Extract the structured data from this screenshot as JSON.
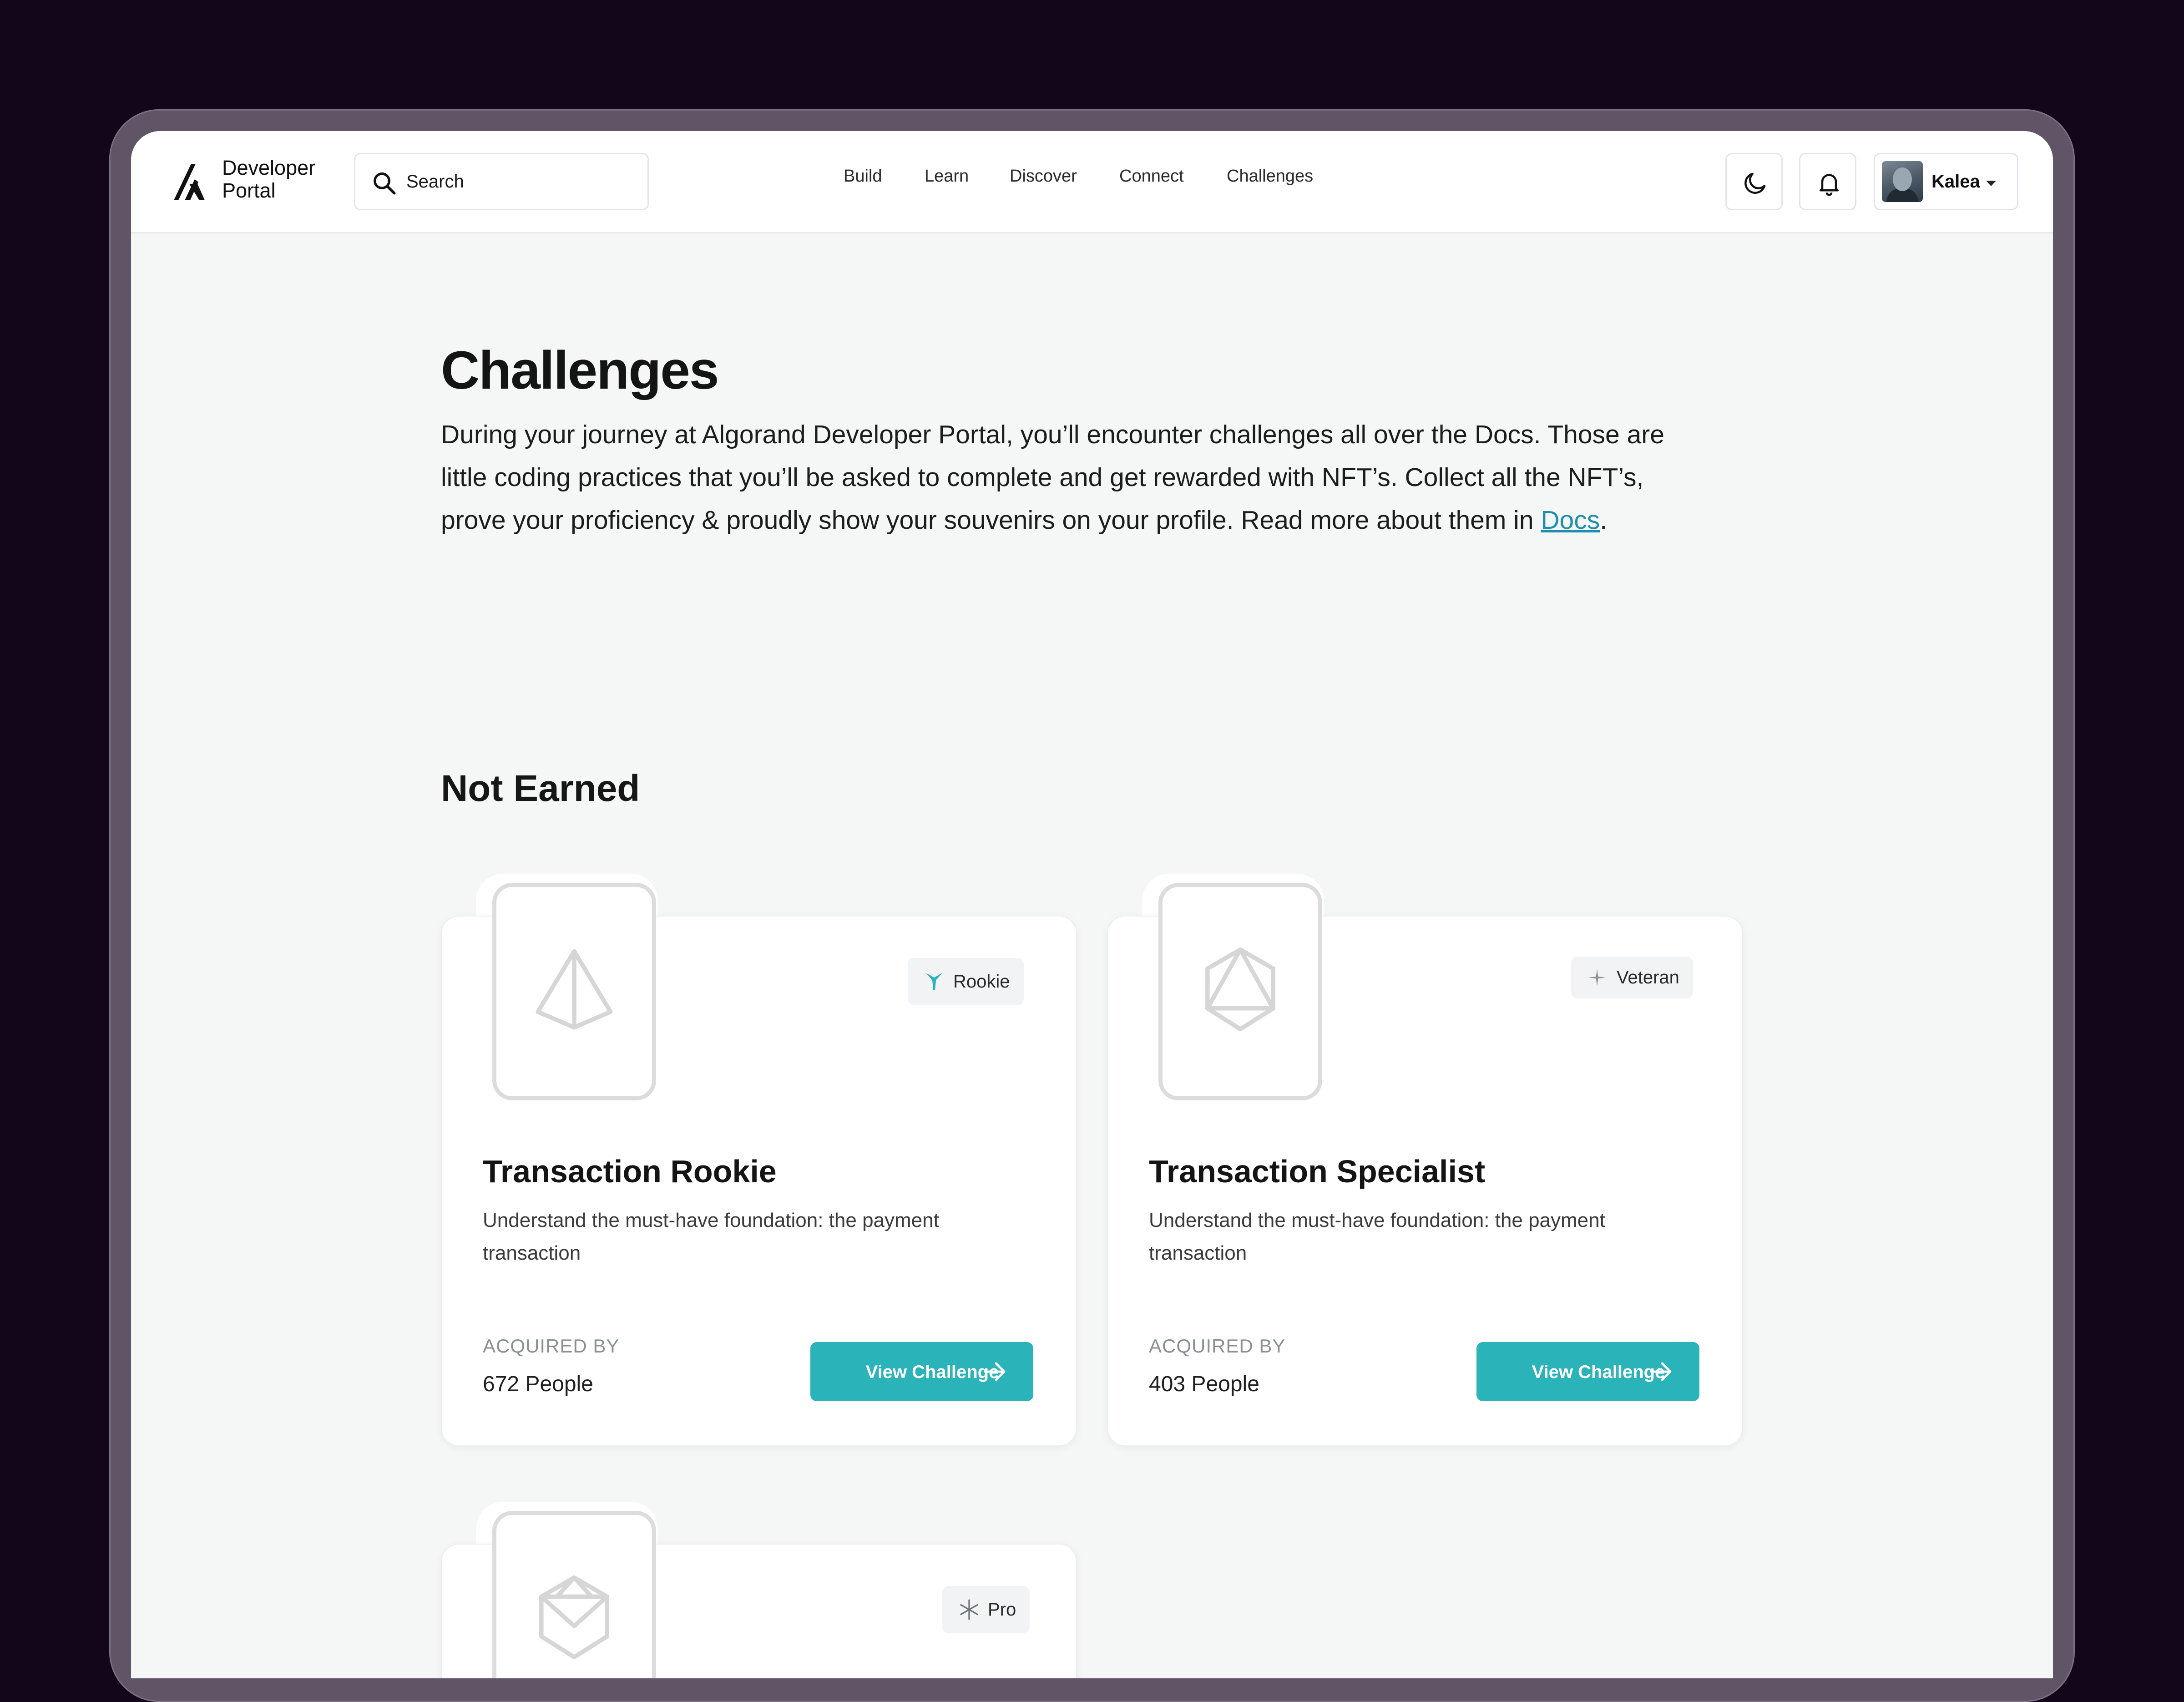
{
  "header": {
    "logo_line1": "Developer",
    "logo_line2": "Portal",
    "search_placeholder": "Search",
    "nav": [
      "Build",
      "Learn",
      "Discover",
      "Connect",
      "Challenges"
    ],
    "username": "Kalea"
  },
  "hero": {
    "title": "Challenges",
    "intro_text": "During your journey at Algorand Developer Portal, you’ll encounter challenges all over the Docs. Those are little coding practices that you’ll be asked to complete and get rewarded with NFT’s. Collect all the NFT’s, prove your proficiency & proudly show your souvenirs on your profile. Read more about them in ",
    "docs_link": "Docs",
    "intro_end": "."
  },
  "section": {
    "title": "Not Earned"
  },
  "cards": [
    {
      "badge": "Rookie",
      "badge_icon": "rookie-arrow-icon",
      "title": "Transaction Rookie",
      "description": "Understand the must-have foundation: the payment transaction",
      "acquired_label": "ACQUIRED BY",
      "acquired_value": "672 People",
      "button": "View Challenge"
    },
    {
      "badge": "Veteran",
      "badge_icon": "veteran-sparkle-icon",
      "title": "Transaction Specialist",
      "description": "Understand the must-have foundation: the payment transaction",
      "acquired_label": "ACQUIRED BY",
      "acquired_value": "403 People",
      "button": "View Challenge"
    },
    {
      "badge": "Pro",
      "badge_icon": "pro-star-icon"
    }
  ],
  "colors": {
    "accent": "#2ab3b8",
    "link": "#1f8db0",
    "page_bg": "#f5f7f6",
    "backdrop": "#1e0b24"
  }
}
